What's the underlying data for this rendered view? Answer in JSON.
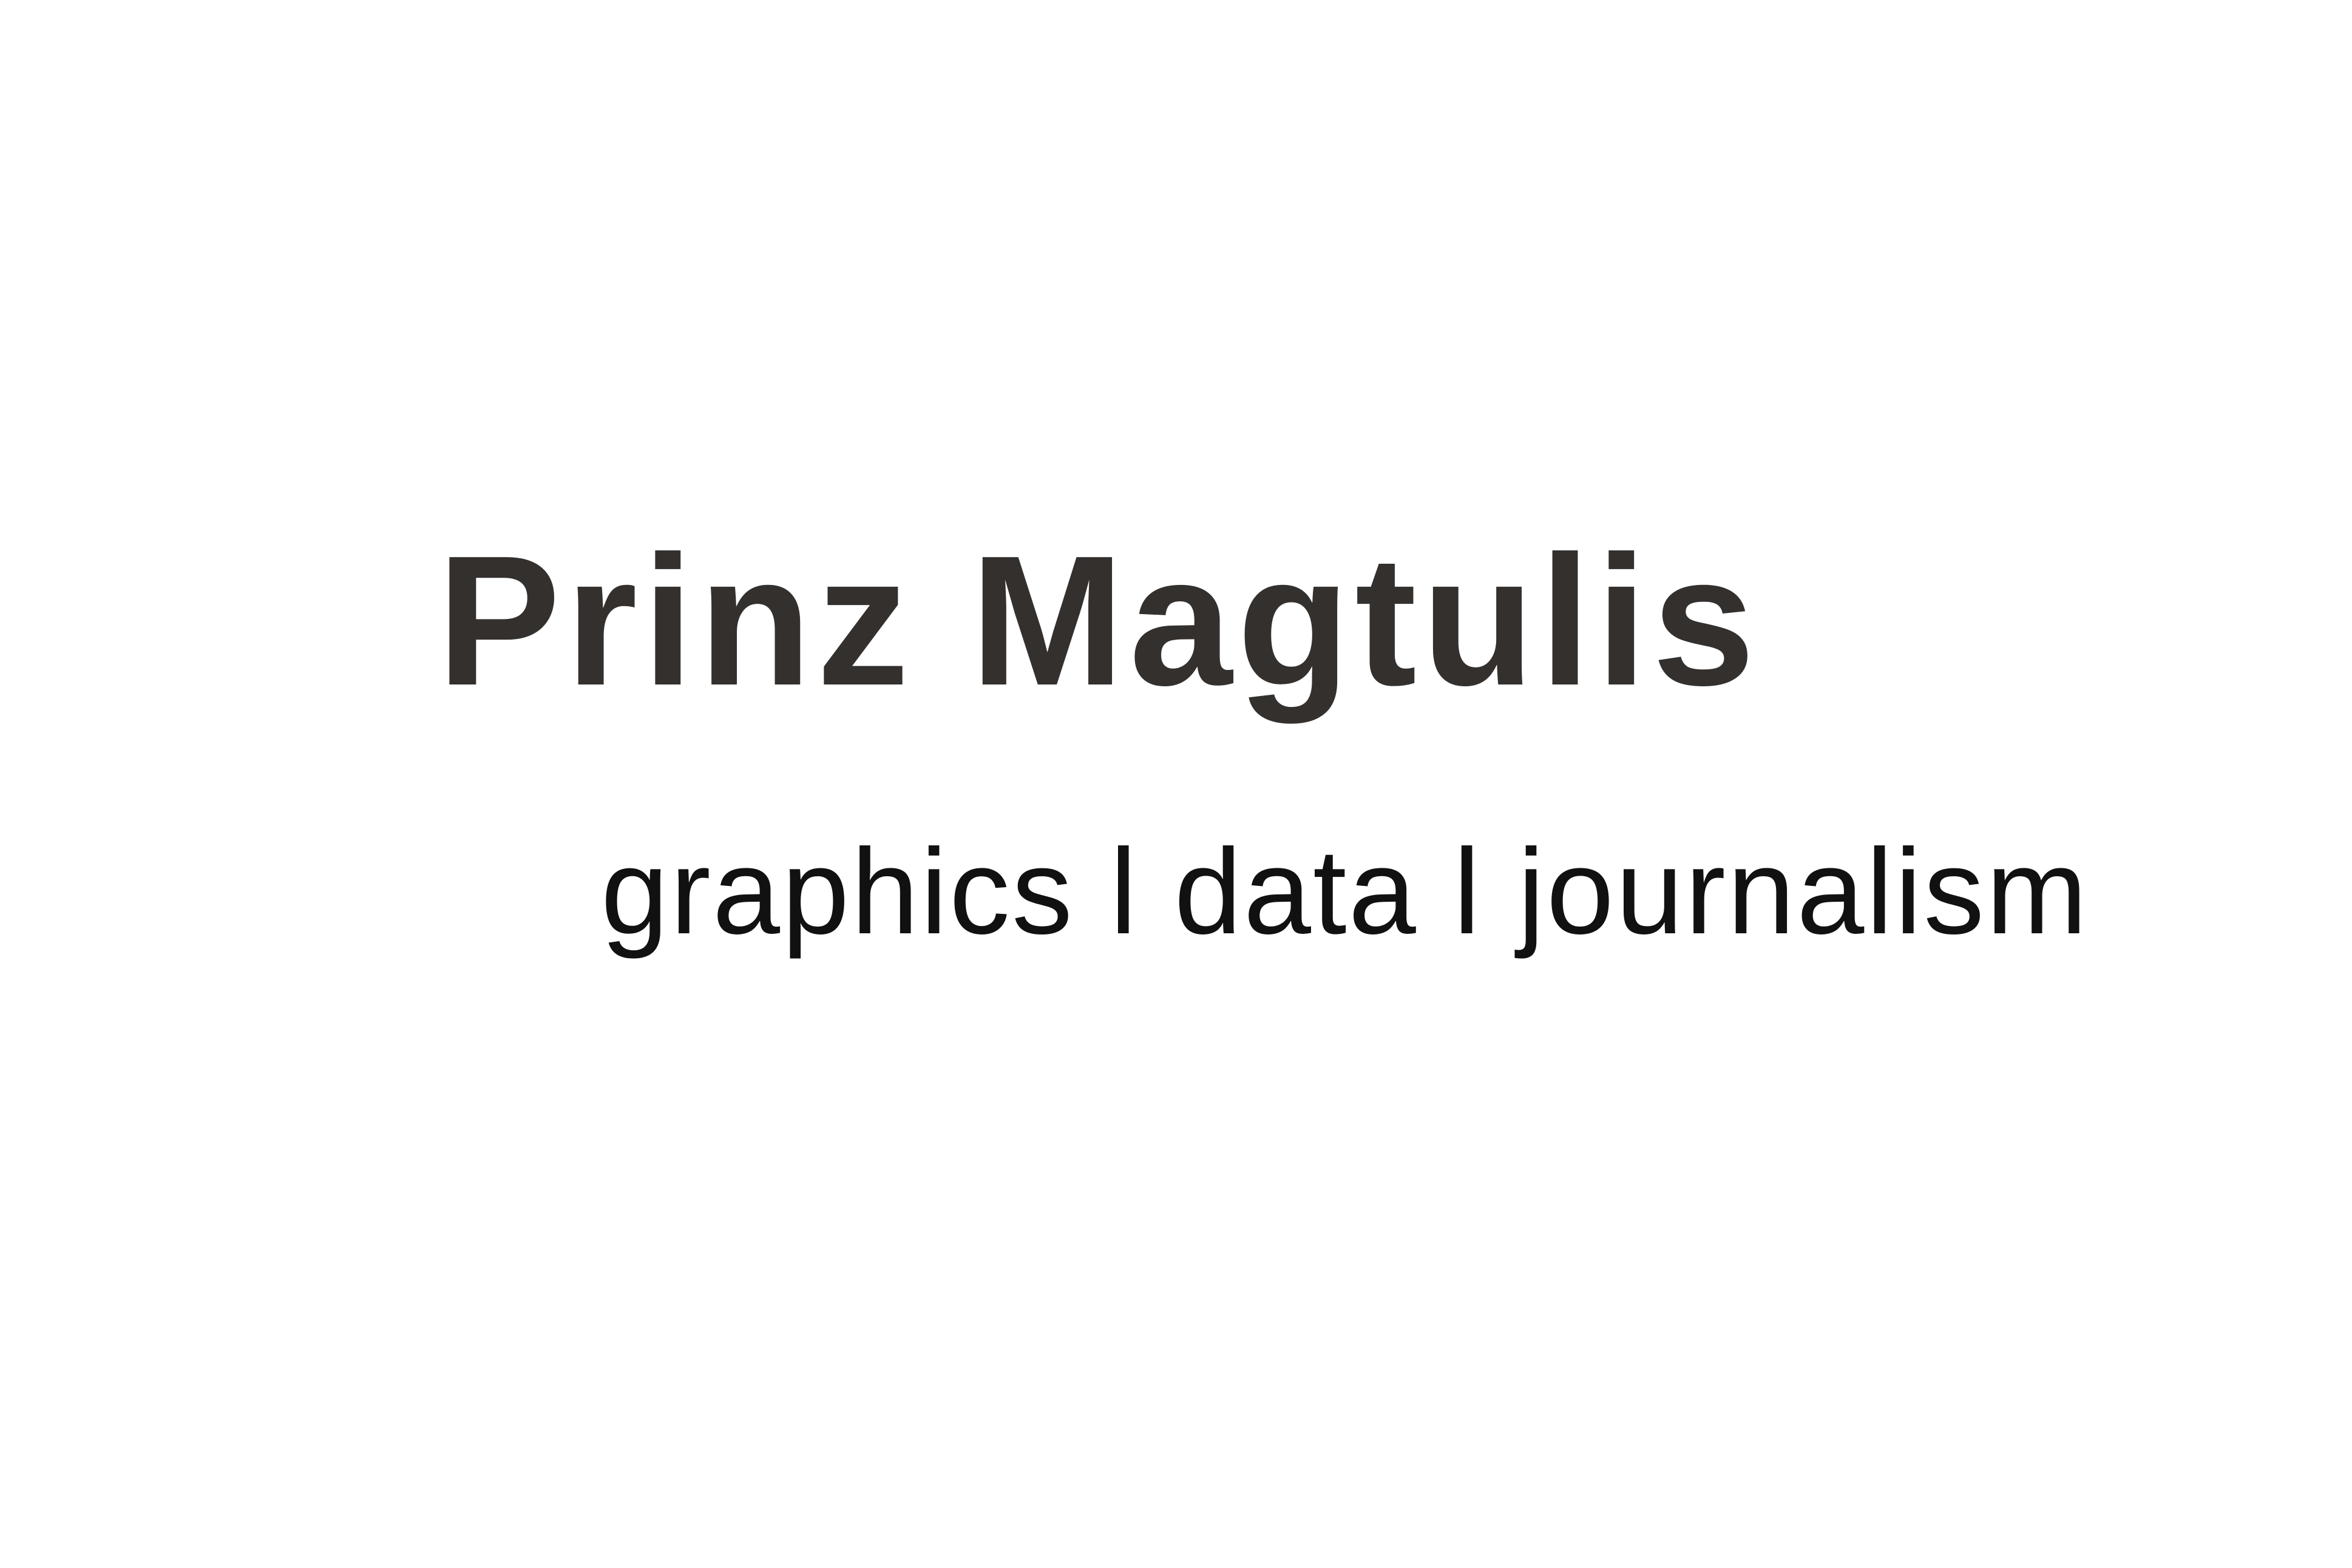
{
  "title": "Prinz Magtulis",
  "tagline": "graphics l data l journalism",
  "colors": {
    "background": "#ffffff",
    "title_text": "#33302e",
    "tagline_text": "#111111"
  }
}
